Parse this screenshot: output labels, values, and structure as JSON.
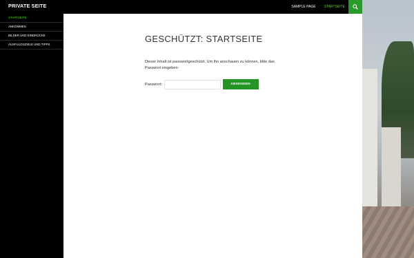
{
  "site": {
    "title": "PRIVATE SEITE"
  },
  "top_nav": {
    "items": [
      {
        "label": "SAMPLE PAGE"
      },
      {
        "label": "STARTSEITE"
      }
    ],
    "search_icon": "search-icon"
  },
  "sidebar": {
    "items": [
      {
        "label": "STARTSEITE"
      },
      {
        "label": "ANKOMMEN"
      },
      {
        "label": "BILDER UND EINDRÜCKE"
      },
      {
        "label": "AUSFLUGSZIELE UND TIPPS"
      }
    ]
  },
  "main": {
    "title": "GESCHÜTZT: STARTSEITE",
    "intro_text": "Dieser Inhalt ist passwortgeschützt. Um ihn anschauen zu können, bitte das Passwort eingeben:",
    "password_label": "Passwort:",
    "password_value": "",
    "submit_label": "ABSENDEN"
  },
  "colors": {
    "accent": "#5bd12a",
    "button": "#249524",
    "navbar": "#000000"
  }
}
